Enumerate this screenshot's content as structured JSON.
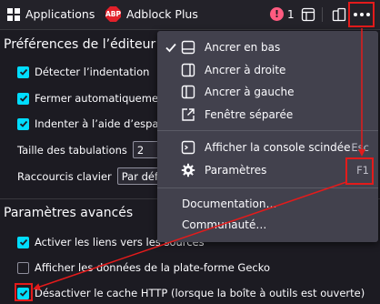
{
  "toolbar": {
    "apps_label": "Applications",
    "abp_badge": "ABP",
    "abp_label": "Adblock Plus",
    "error_count": "1",
    "icons": [
      "grid-icon",
      "abp-icon",
      "error-icon",
      "layout-icon",
      "split-icon",
      "more-icon"
    ]
  },
  "editor": {
    "title": "Préférences de l’éditeur",
    "options": [
      {
        "label": "Détecter l’indentation",
        "checked": true
      },
      {
        "label": "Fermer automatiquement les",
        "checked": true
      },
      {
        "label": "Indenter à l’aide d’espaces",
        "checked": true
      }
    ],
    "tab_size_label": "Taille des tabulations",
    "tab_size_value": "2",
    "keymap_label": "Raccourcis clavier",
    "keymap_value": "Par défaut"
  },
  "advanced": {
    "title": "Paramètres avancés",
    "options": [
      {
        "label": "Activer les liens vers les sources",
        "checked": true
      },
      {
        "label": "Afficher les données de la plate-forme Gecko",
        "checked": false
      },
      {
        "label": "Désactiver le cache HTTP (lorsque la boîte à outils est ouverte)",
        "checked": true
      }
    ]
  },
  "menu": {
    "items": [
      {
        "label": "Ancrer en bas",
        "checked": true,
        "icon": "dock-bottom-icon",
        "shortcut": ""
      },
      {
        "label": "Ancrer à droite",
        "checked": false,
        "icon": "dock-right-icon",
        "shortcut": ""
      },
      {
        "label": "Ancrer à gauche",
        "checked": false,
        "icon": "dock-left-icon",
        "shortcut": ""
      },
      {
        "label": "Fenêtre séparée",
        "checked": false,
        "icon": "separate-window-icon",
        "shortcut": ""
      },
      {
        "label": "Afficher la console scindée",
        "checked": false,
        "icon": "console-icon",
        "shortcut": "Esc"
      },
      {
        "label": "Paramètres",
        "checked": false,
        "icon": "gear-icon",
        "shortcut": "F1"
      },
      {
        "label": "Documentation…",
        "checked": false,
        "icon": "",
        "shortcut": ""
      },
      {
        "label": "Communauté…",
        "checked": false,
        "icon": "",
        "shortcut": ""
      }
    ]
  },
  "colors": {
    "background": "#1c1b22",
    "menu_background": "#42414d",
    "accent": "#00ddff",
    "annotation_red": "#e31b1b",
    "error": "#ff5b80"
  }
}
